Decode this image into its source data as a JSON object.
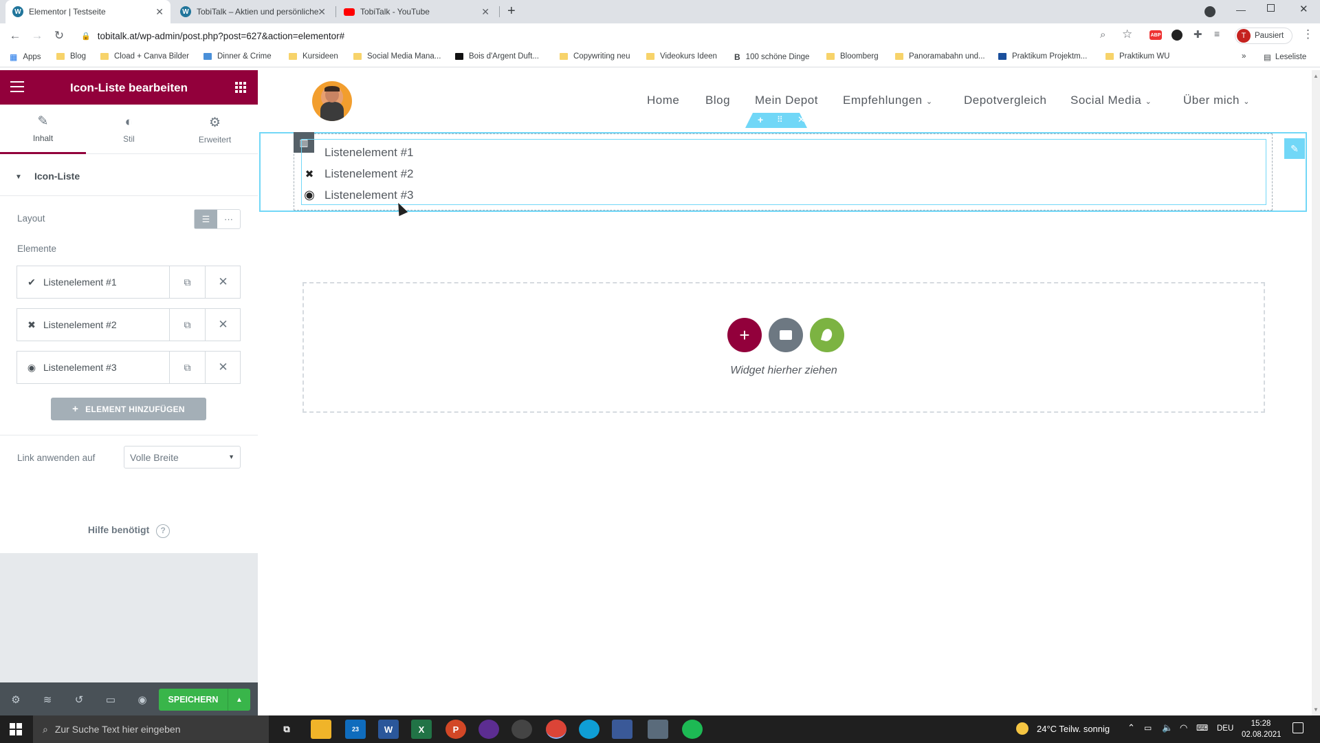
{
  "browser": {
    "tabs": [
      {
        "title": "Elementor | Testseite",
        "active": true
      },
      {
        "title": "TobiTalk – Aktien und persönliche",
        "active": false
      },
      {
        "title": "TobiTalk - YouTube",
        "active": false
      }
    ],
    "url": "tobitalk.at/wp-admin/post.php?post=627&action=elementor#",
    "profile_label": "Pausiert",
    "profile_initial": "T",
    "bookmarks": [
      "Apps",
      "Blog",
      "Cload + Canva Bilder",
      "Dinner & Crime",
      "Kursideen",
      "Social Media Mana...",
      "Bois d'Argent Duft...",
      "Copywriting neu",
      "Videokurs Ideen",
      "100 schöne Dinge",
      "Bloomberg",
      "Panoramabahn und...",
      "Praktikum Projektm...",
      "Praktikum WU"
    ],
    "reading_list": "Leseliste"
  },
  "panel": {
    "title": "Icon-Liste bearbeiten",
    "tabs": [
      {
        "label": "Inhalt",
        "icon": "pencil-icon"
      },
      {
        "label": "Stil",
        "icon": "contrast-icon"
      },
      {
        "label": "Erweitert",
        "icon": "gear-icon"
      }
    ],
    "section_title": "Icon-Liste",
    "layout_label": "Layout",
    "elements_label": "Elemente",
    "items": [
      {
        "label": "Listenelement #1",
        "icon": "check-icon"
      },
      {
        "label": "Listenelement #2",
        "icon": "times-icon"
      },
      {
        "label": "Listenelement #3",
        "icon": "dot-circle-icon"
      }
    ],
    "add_button": "ELEMENT HINZUFÜGEN",
    "link_label": "Link anwenden auf",
    "link_value": "Volle Breite",
    "help_text": "Hilfe benötigt",
    "save_label": "SPEICHERN"
  },
  "site": {
    "nav": [
      {
        "label": "Home",
        "dropdown": false
      },
      {
        "label": "Blog",
        "dropdown": false
      },
      {
        "label": "Mein Depot",
        "dropdown": false
      },
      {
        "label": "Empfehlungen",
        "dropdown": true
      },
      {
        "label": "Depotvergleich",
        "dropdown": false
      },
      {
        "label": "Social Media",
        "dropdown": true
      },
      {
        "label": "Über mich",
        "dropdown": true
      }
    ],
    "list_items": [
      "Listenelement #1",
      "Listenelement #2",
      "Listenelement #3"
    ],
    "drop_hint": "Widget hierher ziehen"
  },
  "taskbar": {
    "search_placeholder": "Zur Suche Text hier eingeben",
    "weather": "24°C  Teilw. sonnig",
    "lang": "DEU",
    "time": "15:28",
    "date": "02.08.2021",
    "mail_badge": "23"
  },
  "colors": {
    "elementor_primary": "#92003b",
    "save_green": "#39b54a",
    "selection_blue": "#71d7f7",
    "dark_grey": "#495157"
  }
}
